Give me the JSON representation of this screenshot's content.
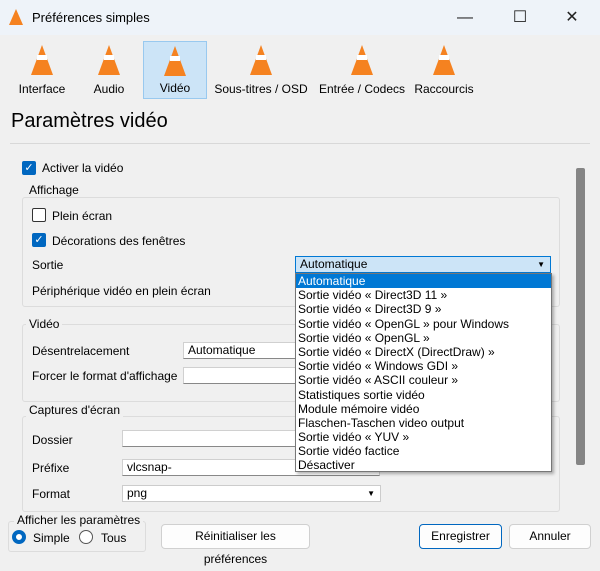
{
  "window": {
    "title": "Préférences simples",
    "minimize": "—",
    "maximize": "☐",
    "close": "✕"
  },
  "toolbar": [
    {
      "label": "Interface",
      "color": "#2e9e3a"
    },
    {
      "label": "Audio",
      "color": "#f58220"
    },
    {
      "label": "Vidéo",
      "color": "#f58220"
    },
    {
      "label": "Sous-titres / OSD",
      "color": "#f58220"
    },
    {
      "label": "Entrée / Codecs",
      "color": "#f58220"
    },
    {
      "label": "Raccourcis",
      "color": "#f58220"
    }
  ],
  "heading": "Paramètres vidéo",
  "enable_video": {
    "label": "Activer la vidéo",
    "checked": true
  },
  "display": {
    "title": "Affichage",
    "fullscreen": "Plein écran",
    "decorations": "Décorations des fenêtres",
    "output_label": "Sortie",
    "output_value": "Automatique",
    "fs_device_label": "Périphérique vidéo en plein écran"
  },
  "output_options": [
    "Automatique",
    "Sortie vidéo « Direct3D 11 »",
    "Sortie vidéo « Direct3D 9 »",
    "Sortie vidéo « OpenGL » pour Windows",
    "Sortie vidéo « OpenGL »",
    "Sortie vidéo « DirectX (DirectDraw) »",
    "Sortie vidéo « Windows GDI »",
    "Sortie vidéo « ASCII couleur »",
    "Statistiques sortie vidéo",
    "Module mémoire vidéo",
    "Flaschen-Taschen video output",
    "Sortie vidéo « YUV »",
    "Sortie vidéo factice",
    "Désactiver"
  ],
  "video": {
    "title": "Vidéo",
    "deinterlace_label": "Désentrelacement",
    "deinterlace_value": "Automatique",
    "aspect_label": "Forcer le format d'affichage",
    "aspect_value": ""
  },
  "snapshots": {
    "title": "Captures d'écran",
    "folder_label": "Dossier",
    "folder_value": "",
    "prefix_label": "Préfixe",
    "prefix_value": "vlcsnap-",
    "format_label": "Format",
    "format_value": "png"
  },
  "show_settings": {
    "title": "Afficher les paramètres",
    "simple": "Simple",
    "all": "Tous"
  },
  "buttons": {
    "reset": "Réinitialiser les préférences",
    "save": "Enregistrer",
    "cancel": "Annuler"
  }
}
